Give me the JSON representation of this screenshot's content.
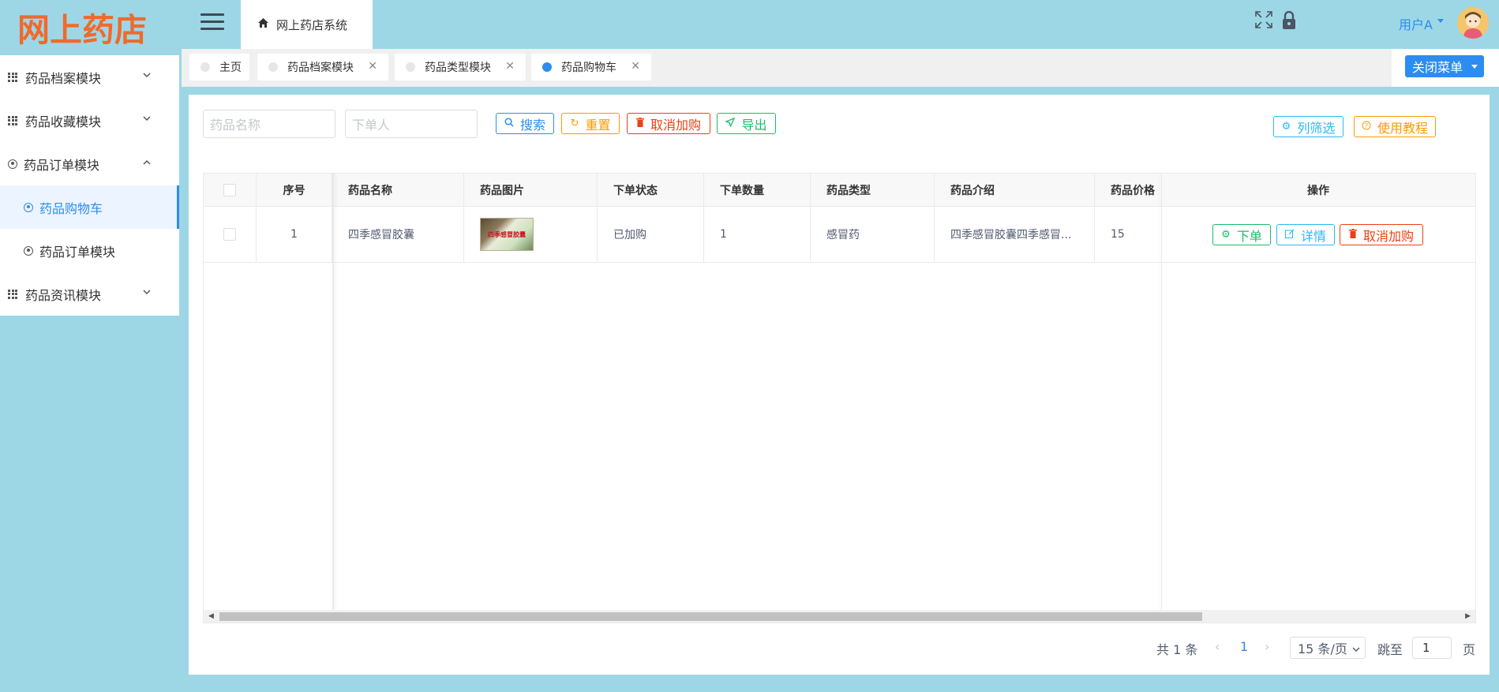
{
  "app": {
    "logo_text": "网上药店",
    "system_tab": "网上药店系统"
  },
  "header": {
    "user_name": "用户A",
    "icons": [
      "fullscreen-icon",
      "lock-icon"
    ]
  },
  "sidebar": {
    "items": [
      {
        "label": "药品档案模块",
        "icon": "grid-icon",
        "expanded": false
      },
      {
        "label": "药品收藏模块",
        "icon": "grid-icon",
        "expanded": false
      },
      {
        "label": "药品订单模块",
        "icon": "circle-icon",
        "expanded": true,
        "children": [
          {
            "label": "药品购物车",
            "active": true
          },
          {
            "label": "药品订单模块",
            "active": false
          }
        ]
      },
      {
        "label": "药品资讯模块",
        "icon": "grid-icon",
        "expanded": false
      }
    ]
  },
  "tabs": [
    {
      "label": "主页",
      "closable": false,
      "active": false
    },
    {
      "label": "药品档案模块",
      "closable": true,
      "active": false
    },
    {
      "label": "药品类型模块",
      "closable": true,
      "active": false
    },
    {
      "label": "药品购物车",
      "closable": true,
      "active": true
    }
  ],
  "close_menu_label": "关闭菜单",
  "filters": {
    "name_placeholder": "药品名称",
    "orderer_placeholder": "下单人"
  },
  "toolbar": {
    "search": "搜索",
    "reset": "重置",
    "cancel_cart": "取消加购",
    "export": "导出",
    "column_filter": "列筛选",
    "tutorial": "使用教程"
  },
  "table": {
    "headers": [
      "序号",
      "药品名称",
      "药品图片",
      "下单状态",
      "下单数量",
      "药品类型",
      "药品介绍",
      "药品价格",
      "操作"
    ],
    "rows": [
      {
        "index": "1",
        "name": "四季感冒胶囊",
        "image_text": "四季感冒胶囊",
        "status": "已加购",
        "quantity": "1",
        "type": "感冒药",
        "intro": "四季感冒胶囊四季感冒...",
        "price": "15",
        "actions": {
          "order": "下单",
          "detail": "详情",
          "cancel": "取消加购"
        }
      }
    ]
  },
  "pagination": {
    "total": "共 1 条",
    "current_page": "1",
    "page_size": "15 条/页",
    "jump_label": "跳至",
    "jump_value": "1",
    "page_suffix": "页"
  },
  "colors": {
    "accent": "#2d8cf0",
    "header_bg": "#9dd7e6",
    "logo": "#f06a2b"
  }
}
